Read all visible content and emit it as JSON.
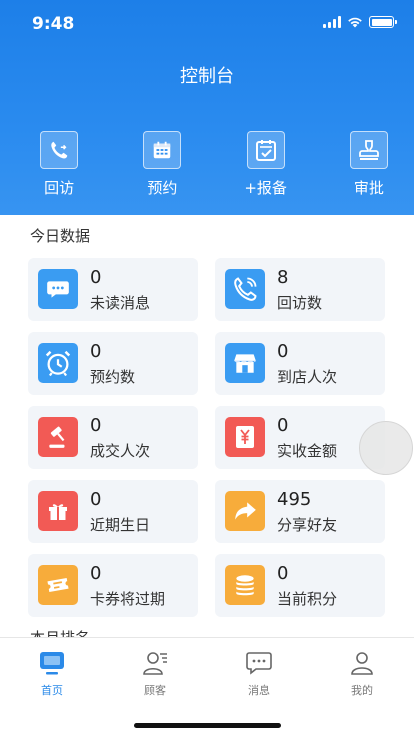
{
  "status": {
    "time": "9:48"
  },
  "page": {
    "title": "控制台"
  },
  "quick_actions": [
    {
      "label": "回访",
      "icon": "phone-callback-icon"
    },
    {
      "label": "预约",
      "icon": "calendar-icon"
    },
    {
      "label": "+报备",
      "icon": "clipboard-check-icon"
    },
    {
      "label": "审批",
      "icon": "stamp-icon"
    }
  ],
  "sections": {
    "today_title": "今日数据",
    "second_title": "本月排名"
  },
  "stats": [
    {
      "value": "0",
      "label": "未读消息",
      "icon": "chat-bubble-icon",
      "color": "#3a9cf2"
    },
    {
      "value": "8",
      "label": "回访数",
      "icon": "phone-icon",
      "color": "#3a9cf2"
    },
    {
      "value": "0",
      "label": "预约数",
      "icon": "alarm-clock-icon",
      "color": "#3a9cf2"
    },
    {
      "value": "0",
      "label": "到店人次",
      "icon": "store-icon",
      "color": "#3a9cf2"
    },
    {
      "value": "0",
      "label": "成交人次",
      "icon": "gavel-icon",
      "color": "#f25a55"
    },
    {
      "value": "0",
      "label": "实收金额",
      "icon": "yen-icon",
      "color": "#f25a55"
    },
    {
      "value": "0",
      "label": "近期生日",
      "icon": "gift-icon",
      "color": "#f25a55"
    },
    {
      "value": "495",
      "label": "分享好友",
      "icon": "share-icon",
      "color": "#f7ac3b"
    },
    {
      "value": "0",
      "label": "卡券将过期",
      "icon": "ticket-icon",
      "color": "#f7ac3b"
    },
    {
      "value": "0",
      "label": "当前积分",
      "icon": "coins-icon",
      "color": "#f7ac3b"
    }
  ],
  "tabs": [
    {
      "label": "首页",
      "icon": "monitor-icon",
      "active": true
    },
    {
      "label": "顾客",
      "icon": "customer-icon",
      "active": false
    },
    {
      "label": "消息",
      "icon": "message-icon",
      "active": false
    },
    {
      "label": "我的",
      "icon": "user-icon",
      "active": false
    }
  ],
  "colors": {
    "accent": "#2b8ae8",
    "header": "#1d7fe8",
    "card_bg": "#f2f5f9"
  }
}
